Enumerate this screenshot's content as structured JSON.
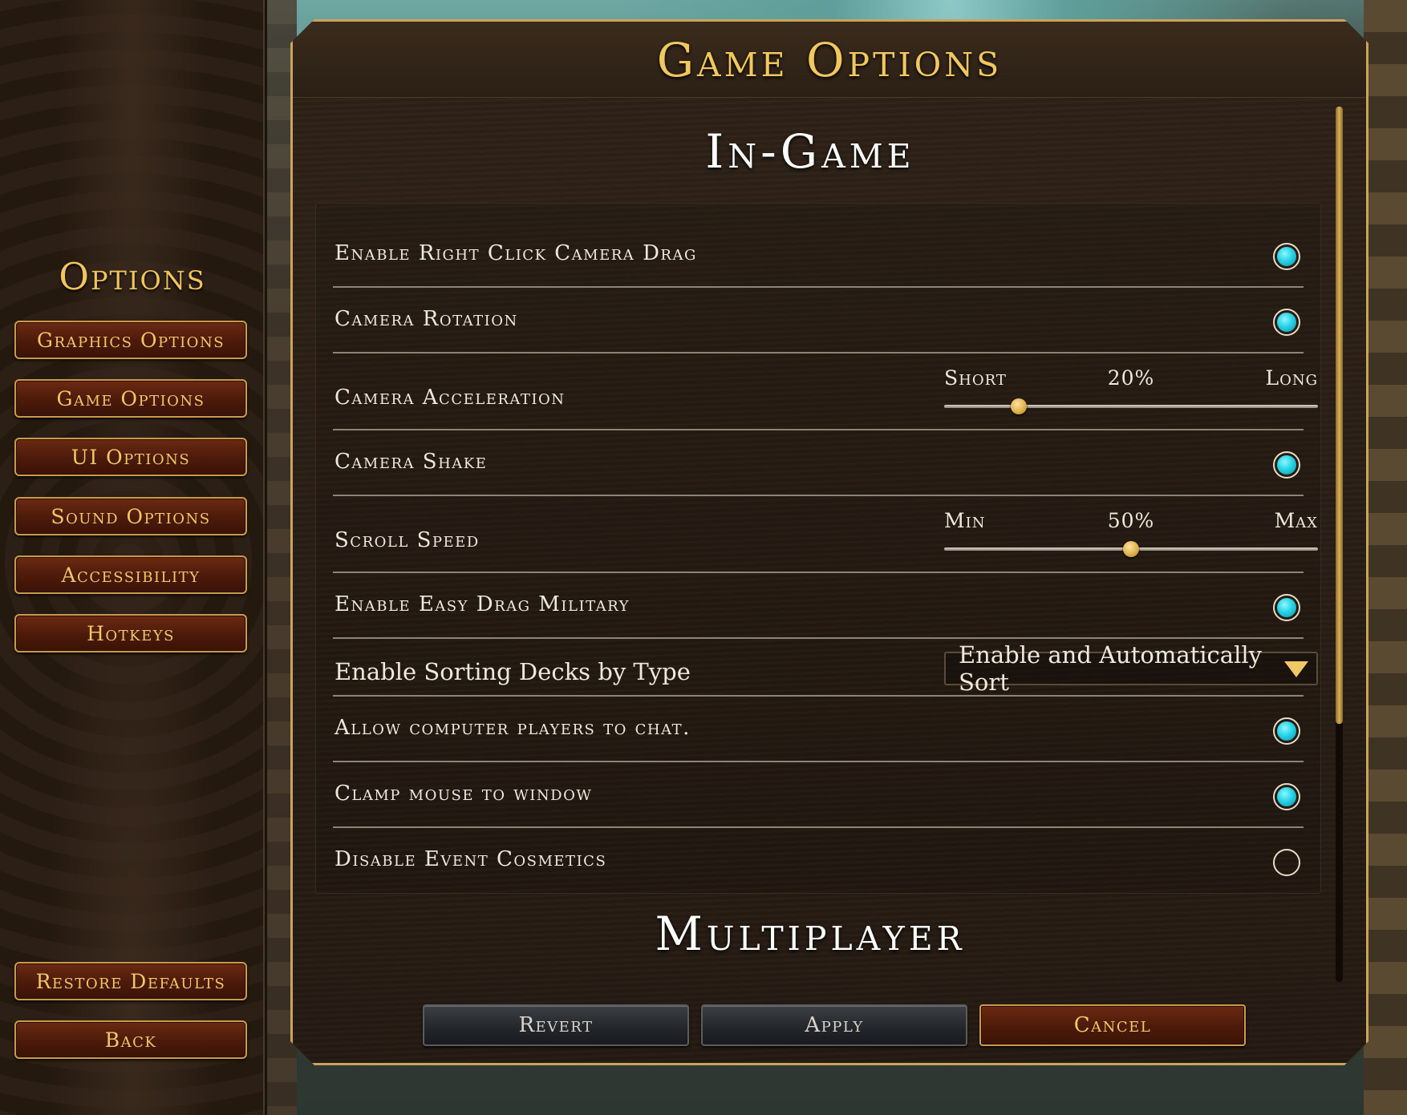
{
  "sidebar": {
    "title": "Options",
    "menu": [
      {
        "label": "Graphics Options"
      },
      {
        "label": "Game Options"
      },
      {
        "label": "UI Options"
      },
      {
        "label": "Sound Options"
      },
      {
        "label": "Accessibility"
      },
      {
        "label": "Hotkeys"
      }
    ],
    "restore_defaults": "Restore Defaults",
    "back": "Back"
  },
  "panel": {
    "title": "Game Options",
    "sections": {
      "in_game": "In-Game",
      "multiplayer": "Multiplayer"
    },
    "settings": {
      "right_click_drag": {
        "label": "Enable Right Click Camera Drag",
        "checked": true
      },
      "camera_rotation": {
        "label": "Camera Rotation",
        "checked": true
      },
      "camera_acceleration": {
        "label": "Camera Acceleration",
        "min_label": "Short",
        "max_label": "Long",
        "value_text": "20%",
        "value": 0.2
      },
      "camera_shake": {
        "label": "Camera Shake",
        "checked": true
      },
      "scroll_speed": {
        "label": "Scroll Speed",
        "min_label": "Min",
        "max_label": "Max",
        "value_text": "50%",
        "value": 0.5
      },
      "easy_drag_military": {
        "label": "Enable Easy Drag Military",
        "checked": true
      },
      "sorting_decks": {
        "label": "Enable Sorting Decks by Type",
        "selected": "Enable and Automatically Sort"
      },
      "computer_chat": {
        "label": "Allow computer players to chat.",
        "checked": true
      },
      "clamp_mouse": {
        "label": "Clamp mouse to window",
        "checked": true
      },
      "disable_event_cosmetics": {
        "label": "Disable Event Cosmetics",
        "checked": false
      }
    },
    "buttons": {
      "revert": "Revert",
      "apply": "Apply",
      "cancel": "Cancel"
    }
  },
  "colors": {
    "gold_text": "#f2c85e",
    "toggle_on": "#26d3e6",
    "button_red": "#4c1a0a"
  },
  "icons": {
    "dropdown": "chevron-down-icon",
    "slider_handle": "slider-handle"
  }
}
